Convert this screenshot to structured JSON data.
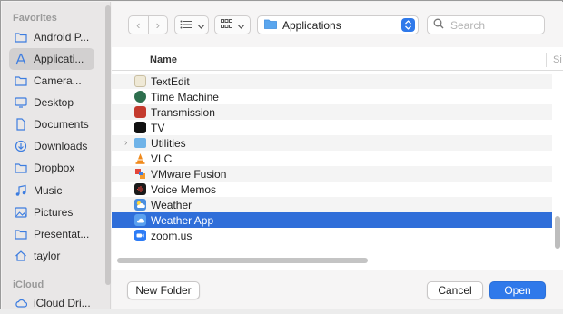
{
  "sidebar": {
    "favorites_label": "Favorites",
    "items": [
      {
        "label": "Android P...",
        "icon": "folder-icon"
      },
      {
        "label": "Applicati...",
        "icon": "applications-icon",
        "selected": true
      },
      {
        "label": "Camera...",
        "icon": "folder-icon"
      },
      {
        "label": "Desktop",
        "icon": "desktop-icon"
      },
      {
        "label": "Documents",
        "icon": "document-icon"
      },
      {
        "label": "Downloads",
        "icon": "download-icon"
      },
      {
        "label": "Dropbox",
        "icon": "folder-icon"
      },
      {
        "label": "Music",
        "icon": "music-icon"
      },
      {
        "label": "Pictures",
        "icon": "pictures-icon"
      },
      {
        "label": "Presentat...",
        "icon": "folder-icon"
      },
      {
        "label": "taylor",
        "icon": "home-icon"
      }
    ],
    "icloud_label": "iCloud",
    "icloud_items": [
      {
        "label": "iCloud Dri...",
        "icon": "cloud-icon"
      }
    ]
  },
  "toolbar": {
    "back_glyph": "‹",
    "forward_glyph": "›",
    "location": "Applications",
    "search_placeholder": "Search"
  },
  "list": {
    "column_name": "Name",
    "column_next": "Si",
    "rows": [
      {
        "label": "TextEdit",
        "color": "#e8e2d0"
      },
      {
        "label": "Time Machine",
        "color": "#2e6f4e"
      },
      {
        "label": "Transmission",
        "color": "#c43a2d"
      },
      {
        "label": "TV",
        "color": "#111111"
      },
      {
        "label": "Utilities",
        "color": "#6fb3e8",
        "folder": true,
        "disclosure": "›"
      },
      {
        "label": "VLC",
        "color": "#f08a1c"
      },
      {
        "label": "VMware Fusion",
        "color": "#e4463a"
      },
      {
        "label": "Voice Memos",
        "color": "#1a1a1a"
      },
      {
        "label": "Weather",
        "color": "#4a8fe0"
      },
      {
        "label": "Weather App",
        "color": "#5aa0ef",
        "selected": true
      },
      {
        "label": "zoom.us",
        "color": "#2d7cf6"
      }
    ]
  },
  "buttons": {
    "new_folder": "New Folder",
    "cancel": "Cancel",
    "open": "Open"
  },
  "colors": {
    "accent": "#2f79ea",
    "selection": "#2f6ed9"
  }
}
